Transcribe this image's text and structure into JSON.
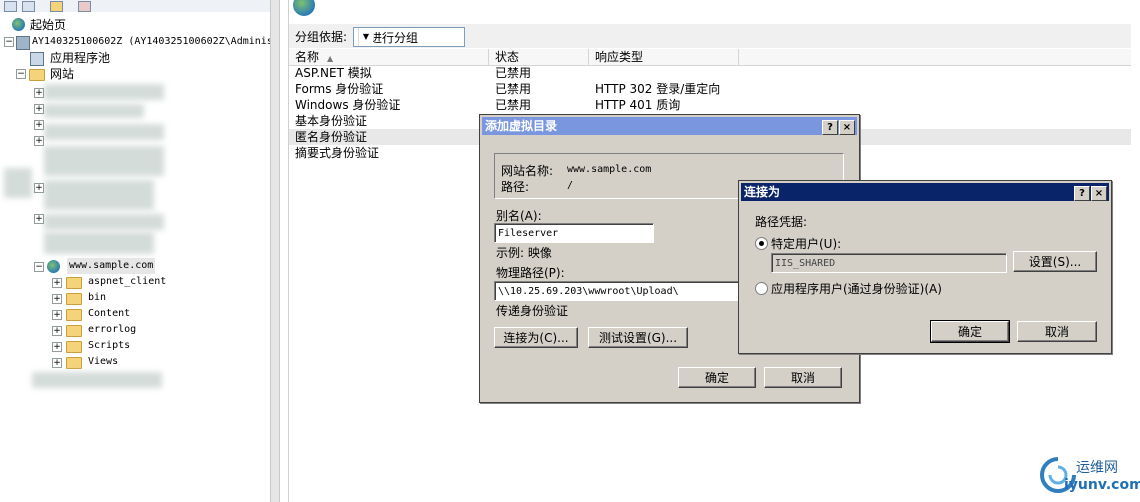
{
  "tree": {
    "start_page": "起始页",
    "server": "AY140325100602Z (AY140325100602Z\\Adminis",
    "app_pools": "应用程序池",
    "sites": "网站",
    "site": "www.sample.com",
    "folders": [
      "aspnet_client",
      "bin",
      "Content",
      "errorlog",
      "Scripts",
      "Views"
    ]
  },
  "group_bar": {
    "label": "分组依据:",
    "value": "不进行分组"
  },
  "columns": {
    "name": "名称",
    "status": "状态",
    "response": "响应类型"
  },
  "auth_rows": [
    {
      "name": "ASP.NET 模拟",
      "status": "已禁用",
      "response": ""
    },
    {
      "name": "Forms 身份验证",
      "status": "已禁用",
      "response": "HTTP 302 登录/重定向"
    },
    {
      "name": "Windows 身份验证",
      "status": "已禁用",
      "response": "HTTP 401 质询"
    },
    {
      "name": "基本身份验证",
      "status": "",
      "response": ""
    },
    {
      "name": "匿名身份验证",
      "status": "",
      "response": ""
    },
    {
      "name": "摘要式身份验证",
      "status": "",
      "response": ""
    }
  ],
  "vdir_dialog": {
    "title": "添加虚拟目录",
    "site_name_label": "网站名称:",
    "site_name_value": "www.sample.com",
    "path_label": "路径:",
    "path_value": "/",
    "alias_label": "别名(A):",
    "alias_value": "Fileserver",
    "example": "示例: 映像",
    "physical_label": "物理路径(P):",
    "physical_value": "\\\\10.25.69.203\\wwwroot\\Upload\\",
    "passthrough": "传递身份验证",
    "connect_as": "连接为(C)...",
    "test_settings": "测试设置(G)...",
    "ok": "确定",
    "cancel": "取消"
  },
  "connect_dialog": {
    "title": "连接为",
    "path_credentials": "路径凭据:",
    "specific_user": "特定用户(U):",
    "user_value": "IIS_SHARED",
    "settings": "设置(S)...",
    "app_user": "应用程序用户(通过身份验证)(A)",
    "ok": "确定",
    "cancel": "取消"
  },
  "title_buttons": {
    "help": "?",
    "close": "×"
  },
  "watermark": {
    "cn": "运维网",
    "url": "iyunv.com"
  },
  "colors": {
    "title_active": "#0a246a",
    "title_inactive": "#7a96df",
    "dialog_bg": "#d4d0c8"
  }
}
